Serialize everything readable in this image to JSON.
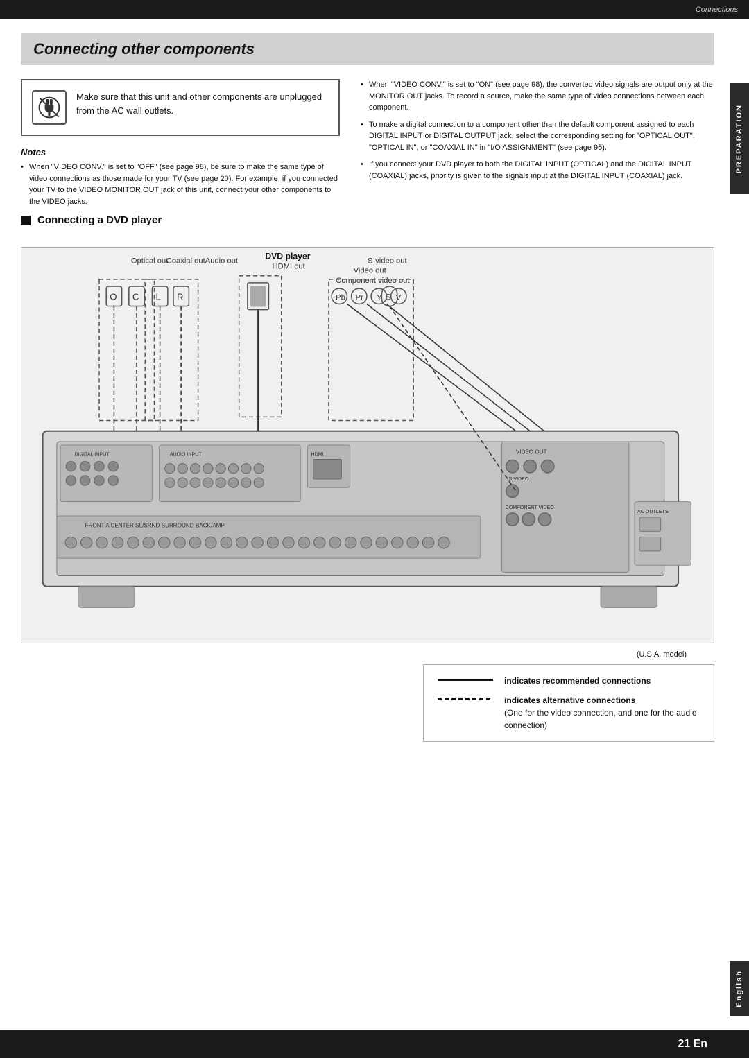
{
  "header": {
    "section_label": "Connections"
  },
  "page_title": "Connecting other components",
  "warning": {
    "text": "Make sure that this unit and other components are unplugged from the AC wall outlets."
  },
  "notes": {
    "title": "Notes",
    "items": [
      "When \"VIDEO CONV.\" is set to \"OFF\" (see page 98), be sure to make the same type of video connections as those made for your TV (see page 20). For example, if you connected your TV to the VIDEO MONITOR OUT jack of this unit, connect your other components to the VIDEO jacks."
    ]
  },
  "right_bullets": [
    "When \"VIDEO CONV.\" is set to \"ON\" (see page 98), the converted video signals are output only at the MONITOR OUT jacks. To record a source, make the same type of video connections between each component.",
    "To make a digital connection to a component other than the default component assigned to each DIGITAL INPUT or DIGITAL OUTPUT jack, select the corresponding setting for \"OPTICAL OUT\", \"OPTICAL IN\", or \"COAXIAL IN\" in \"I/O ASSIGNMENT\" (see page 95).",
    "If you connect your DVD player to both the DIGITAL INPUT (OPTICAL) and the DIGITAL INPUT (COAXIAL) jacks, priority is given to the signals input at the DIGITAL INPUT (COAXIAL) jack."
  ],
  "dvd_section": {
    "heading": "Connecting a DVD player"
  },
  "diagram": {
    "labels": {
      "optical_out": "Optical out",
      "coaxial_out": "Coaxial out",
      "audio_out": "Audio out",
      "hdmi_out": "HDMI out",
      "dvd_player": "DVD player",
      "s_video_out": "S-video out",
      "video_out": "Video out",
      "component_video_out": "Component video out"
    }
  },
  "usa_model": "(U.S.A. model)",
  "legend": {
    "solid_label": "indicates recommended connections",
    "dashed_label": "indicates alternative connections",
    "dashed_sub": "(One for the video connection, and one for the audio connection)"
  },
  "side_tabs": {
    "preparation": "PREPARATION",
    "english": "English"
  },
  "page_number": "21 En"
}
